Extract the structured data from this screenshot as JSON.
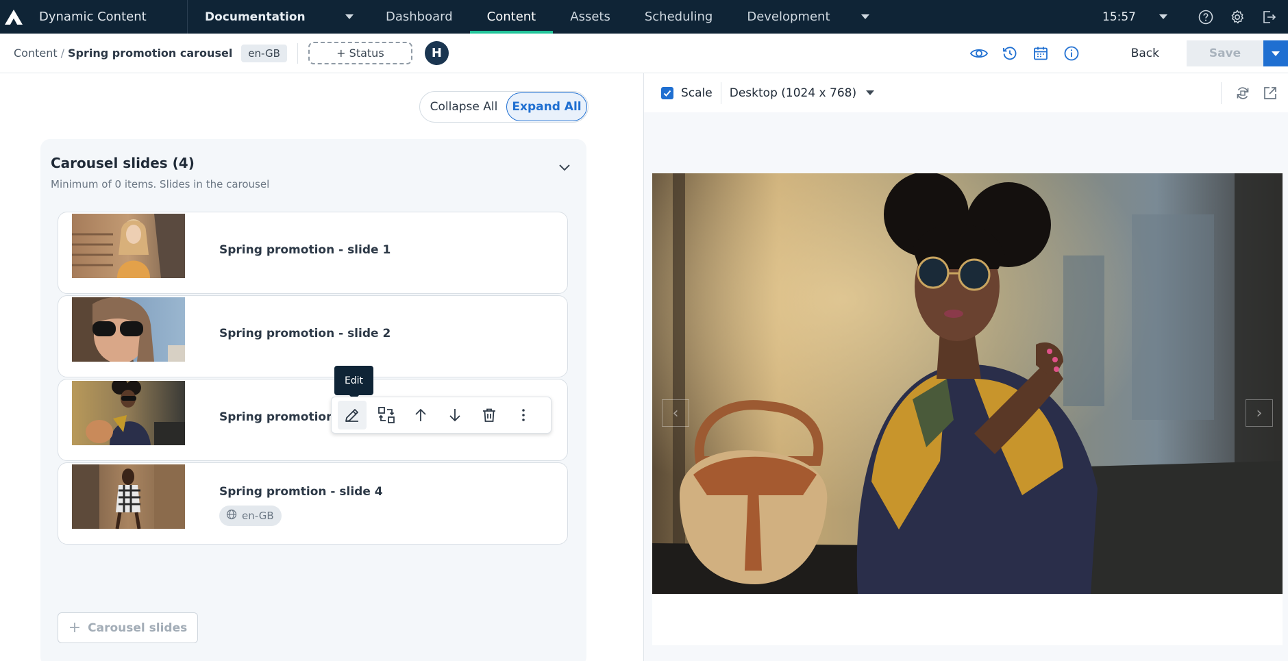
{
  "topnav": {
    "app_title": "Dynamic Content",
    "hub": "Documentation",
    "tabs": [
      {
        "label": "Dashboard",
        "active": false
      },
      {
        "label": "Content",
        "active": true
      },
      {
        "label": "Assets",
        "active": false
      },
      {
        "label": "Scheduling",
        "active": false
      },
      {
        "label": "Development",
        "active": false
      }
    ],
    "clock": "15:57",
    "accent_color": "#23c49a",
    "bg_color": "#0f2436"
  },
  "toolbar": {
    "breadcrumb_root": "Content",
    "breadcrumb_sep": "/",
    "breadcrumb_current": "Spring promotion carousel",
    "locale": "en-GB",
    "status_label": "+ Status",
    "avatar_initial": "H",
    "back_label": "Back",
    "save_label": "Save",
    "primary_color": "#1f6fd1"
  },
  "editor": {
    "collapse_all": "Collapse All",
    "expand_all": "Expand All",
    "panel_title": "Carousel slides (4)",
    "panel_subtitle": "Minimum of 0 items. Slides in the carousel",
    "slides": [
      {
        "title": "Spring promotion - slide 1"
      },
      {
        "title": "Spring promotion - slide 2"
      },
      {
        "title": "Spring promotion - slide 3"
      },
      {
        "title": "Spring promtion - slide 4",
        "locale": "en-GB"
      }
    ],
    "add_label": "Carousel slides",
    "tooltip": "Edit"
  },
  "preview": {
    "scale_label": "Scale",
    "scale_checked": true,
    "device_label": "Desktop (1024 x 768)"
  }
}
